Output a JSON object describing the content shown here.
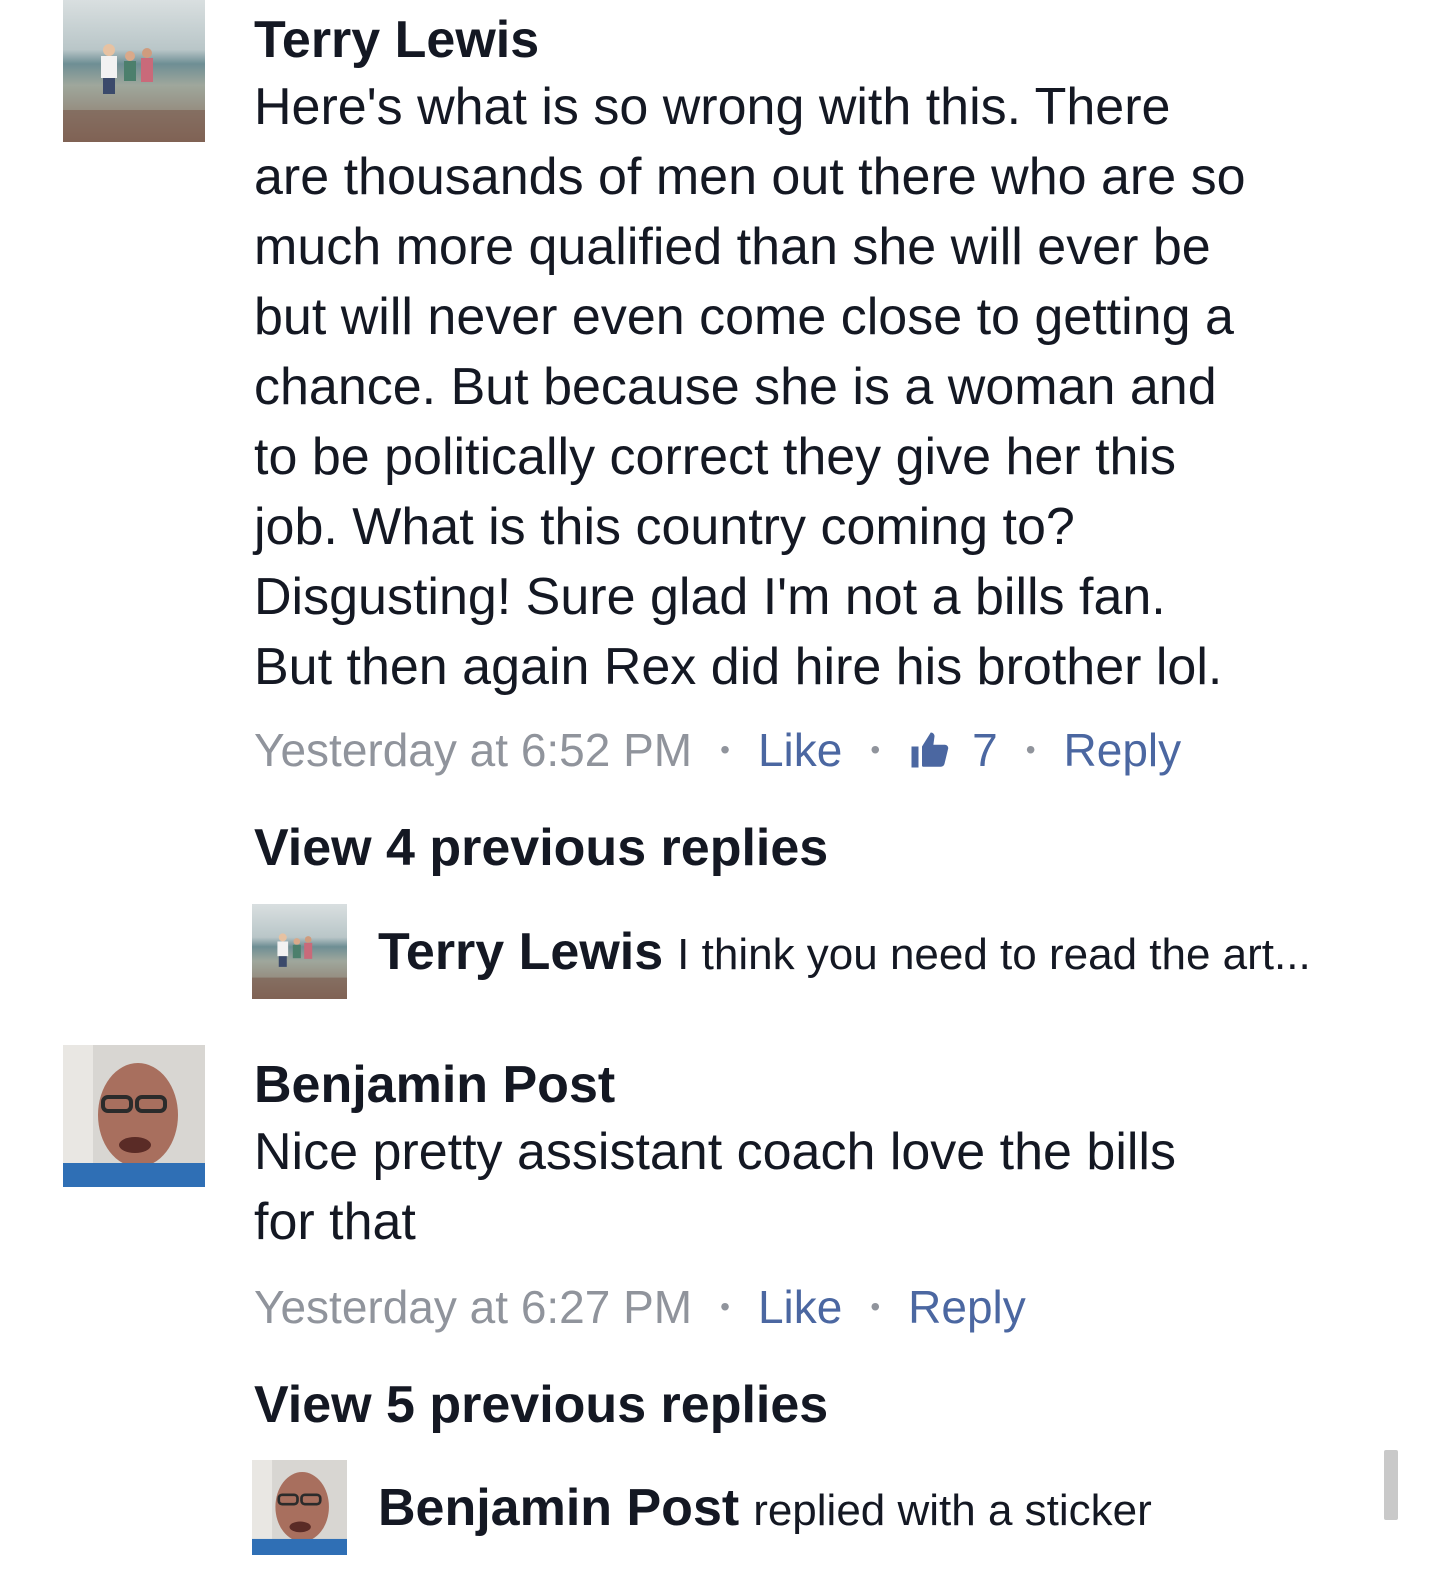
{
  "comments": [
    {
      "author": "Terry Lewis",
      "lines": [
        "Here's what is so wrong with this. There",
        "are thousands of men out there who are so",
        "much more qualified than she will ever be",
        "but will never even come close to getting a",
        "chance. But because she is a woman and",
        "to be politically correct they give her this",
        "job. What is this country coming to?",
        "Disgusting! Sure glad I'm not a bills fan.",
        "But then again Rex did hire his brother lol."
      ],
      "timestamp": "Yesterday at 6:52 PM",
      "like_label": "Like",
      "like_count": "7",
      "reply_label": "Reply",
      "view_replies": "View 4 previous replies",
      "latest_reply": {
        "author": "Terry Lewis",
        "text": "I think you need to read the art..."
      }
    },
    {
      "author": "Benjamin Post",
      "lines": [
        "Nice pretty assistant coach love the bills",
        "for that"
      ],
      "timestamp": "Yesterday at 6:27 PM",
      "like_label": "Like",
      "reply_label": "Reply",
      "view_replies": "View 5 previous replies",
      "latest_reply": {
        "author": "Benjamin Post",
        "text": "replied with a sticker"
      }
    }
  ],
  "separator": "•",
  "colors": {
    "link": "#4b67a1",
    "meta": "#90949c",
    "text": "#141823"
  },
  "icons": {
    "like": "thumbs-up-icon"
  }
}
